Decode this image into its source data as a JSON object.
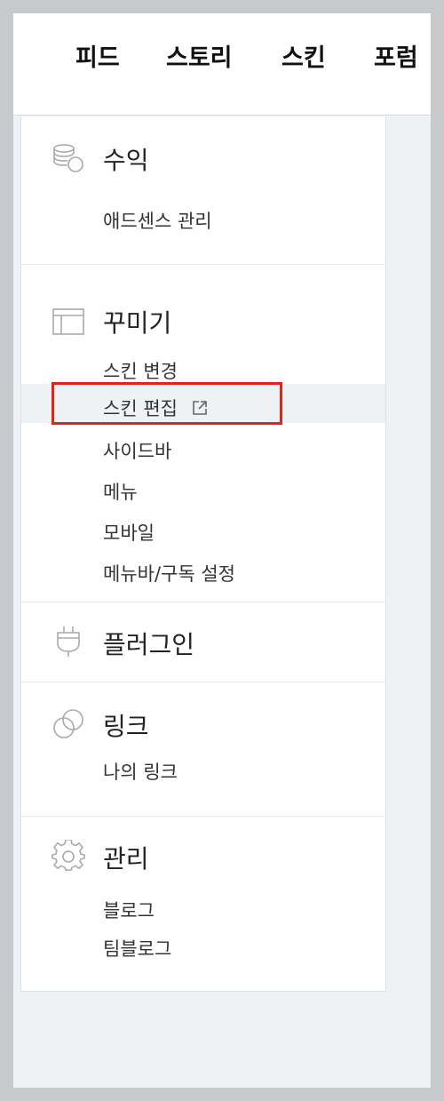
{
  "topnav": {
    "items": [
      {
        "label": "피드"
      },
      {
        "label": "스토리"
      },
      {
        "label": "스킨"
      },
      {
        "label": "포럼"
      }
    ]
  },
  "sidebar": {
    "revenue": {
      "title": "수익",
      "icon": "coins-icon",
      "items": [
        {
          "label": "애드센스 관리"
        }
      ]
    },
    "decorate": {
      "title": "꾸미기",
      "icon": "layout-icon",
      "items": [
        {
          "label": "스킨 변경"
        },
        {
          "label": "스킨 편집",
          "icon": "external-link-icon",
          "highlighted": true
        },
        {
          "label": "사이드바"
        },
        {
          "label": "메뉴"
        },
        {
          "label": "모바일"
        },
        {
          "label": "메뉴바/구독 설정"
        }
      ]
    },
    "plugin": {
      "title": "플러그인",
      "icon": "plug-icon"
    },
    "link": {
      "title": "링크",
      "icon": "link-icon",
      "items": [
        {
          "label": "나의 링크"
        }
      ]
    },
    "manage": {
      "title": "관리",
      "icon": "gear-icon",
      "items": [
        {
          "label": "블로그"
        },
        {
          "label": "팀블로그"
        }
      ]
    }
  },
  "colors": {
    "highlight_box": "#e52313",
    "highlight_row": "#eff2f5",
    "icon_stroke": "#a9a9a9"
  }
}
